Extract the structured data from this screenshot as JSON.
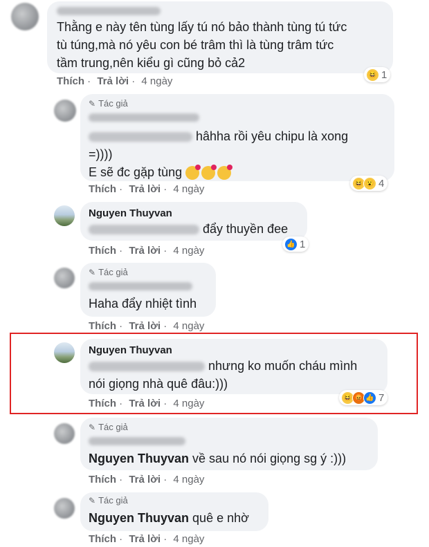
{
  "comments": [
    {
      "id": "c1",
      "text_lines": [
        "Thằng e này tên tùng lấy tú nó bảo thành tùng tú tức",
        "tù túng,mà nó yêu con bé trâm thì là tùng trâm tức",
        "tầm trung,nên kiểu gì cũng bỏ cả2"
      ],
      "reaction_count": "1",
      "reactions": [
        "haha"
      ],
      "actions": {
        "like": "Thích",
        "reply": "Trả lời",
        "time": "4 ngày"
      }
    },
    {
      "id": "c2",
      "author_badge": "Tác giả",
      "text_lines": [
        "hâhha rồi yêu chipu là xong",
        "=))))",
        "E sẽ đc gặp tùng"
      ],
      "reaction_count": "4",
      "reactions": [
        "haha",
        "wow"
      ],
      "actions": {
        "like": "Thích",
        "reply": "Trả lời",
        "time": "4 ngày"
      }
    },
    {
      "id": "c3",
      "name": "Nguyen Thuyvan",
      "text_lines": [
        "đẩy thuyền đee"
      ],
      "reaction_count": "1",
      "reactions": [
        "like"
      ],
      "actions": {
        "like": "Thích",
        "reply": "Trả lời",
        "time": "4 ngày"
      }
    },
    {
      "id": "c4",
      "author_badge": "Tác giả",
      "text_lines": [
        "Haha đẩy nhiệt tình"
      ],
      "actions": {
        "like": "Thích",
        "reply": "Trả lời",
        "time": "4 ngày"
      }
    },
    {
      "id": "c5",
      "name": "Nguyen Thuyvan",
      "text_lines": [
        "nhưng ko muốn cháu mình",
        "nói giọng nhà quê đâu:)))"
      ],
      "reaction_count": "7",
      "reactions": [
        "haha",
        "angry",
        "like"
      ],
      "actions": {
        "like": "Thích",
        "reply": "Trả lời",
        "time": "4 ngày"
      }
    },
    {
      "id": "c6",
      "author_badge": "Tác giả",
      "mention": "Nguyen Thuyvan",
      "text_lines": [
        "về sau nó nói giọng sg ý :)))"
      ],
      "actions": {
        "like": "Thích",
        "reply": "Trả lời",
        "time": "4 ngày"
      }
    },
    {
      "id": "c7",
      "author_badge": "Tác giả",
      "mention": "Nguyen Thuyvan",
      "text_lines": [
        "quê e nhờ"
      ],
      "actions": {
        "like": "Thích",
        "reply": "Trả lời",
        "time": "4 ngày"
      }
    }
  ],
  "colors": {
    "bubble": "#f0f2f5",
    "highlight": "#e02424",
    "meta": "#65676b",
    "like_blue": "#1877f2"
  }
}
